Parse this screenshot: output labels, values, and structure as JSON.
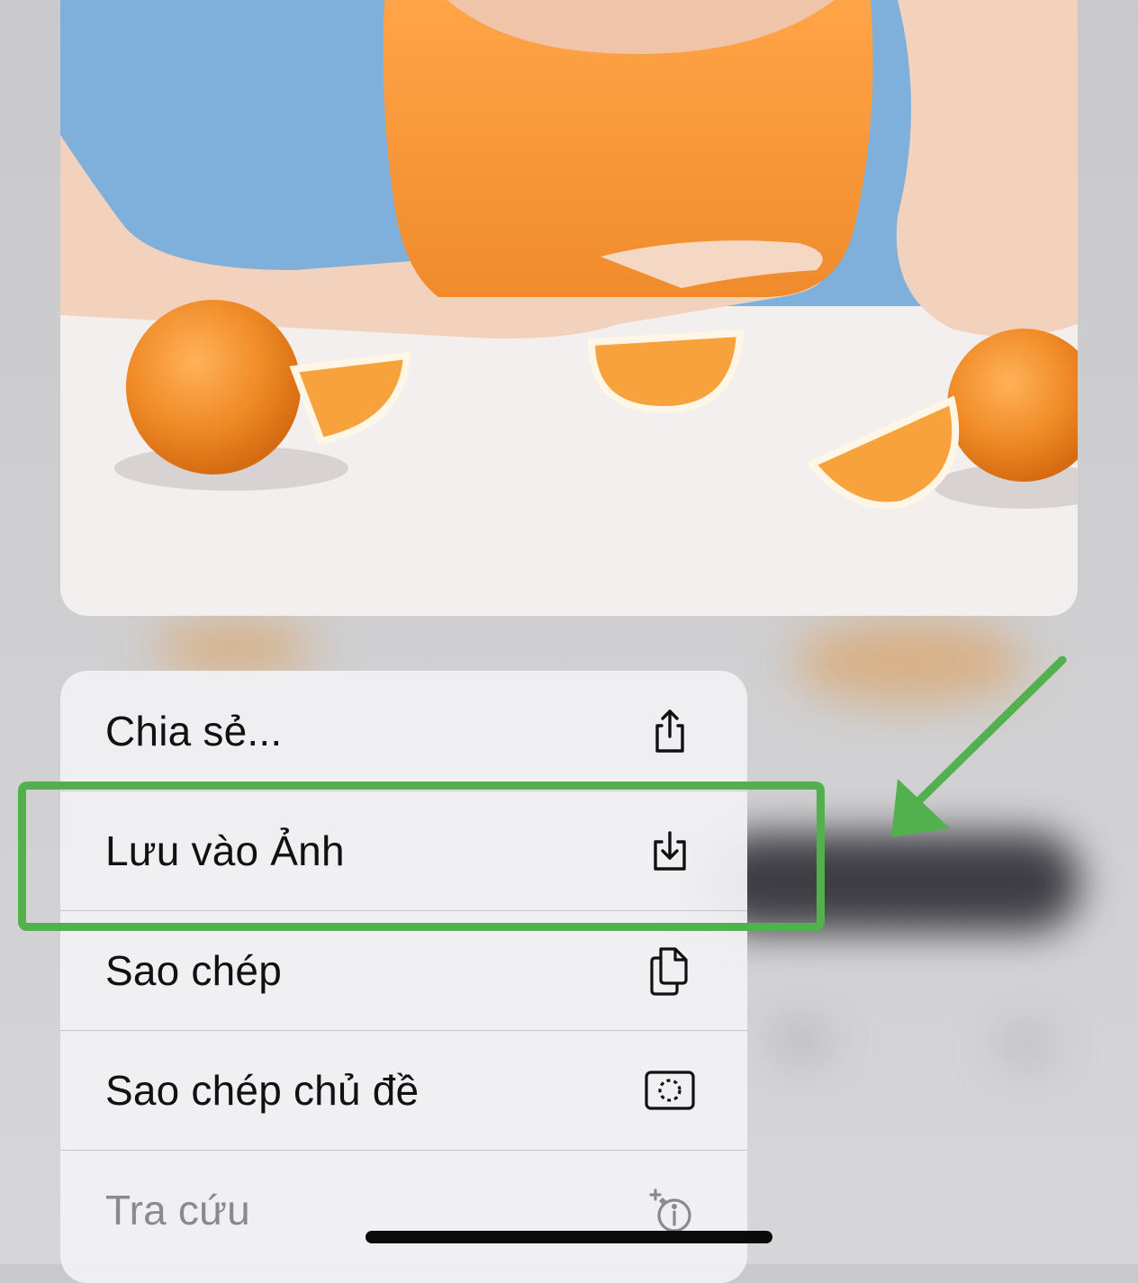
{
  "context_menu": {
    "items": [
      {
        "label": "Chia sẻ...",
        "icon": "share-icon",
        "disabled": false
      },
      {
        "label": "Lưu vào Ảnh",
        "icon": "save-to-photos-icon",
        "disabled": false
      },
      {
        "label": "Sao chép",
        "icon": "copy-icon",
        "disabled": false
      },
      {
        "label": "Sao chép chủ đề",
        "icon": "copy-subject-icon",
        "disabled": false
      },
      {
        "label": "Tra cứu",
        "icon": "visual-look-up-icon",
        "disabled": true
      }
    ]
  },
  "colors": {
    "annotation_green": "#52b04f",
    "menu_background": "#f0f0f2",
    "label_text": "#111111",
    "disabled_text": "#8a8a8e"
  }
}
